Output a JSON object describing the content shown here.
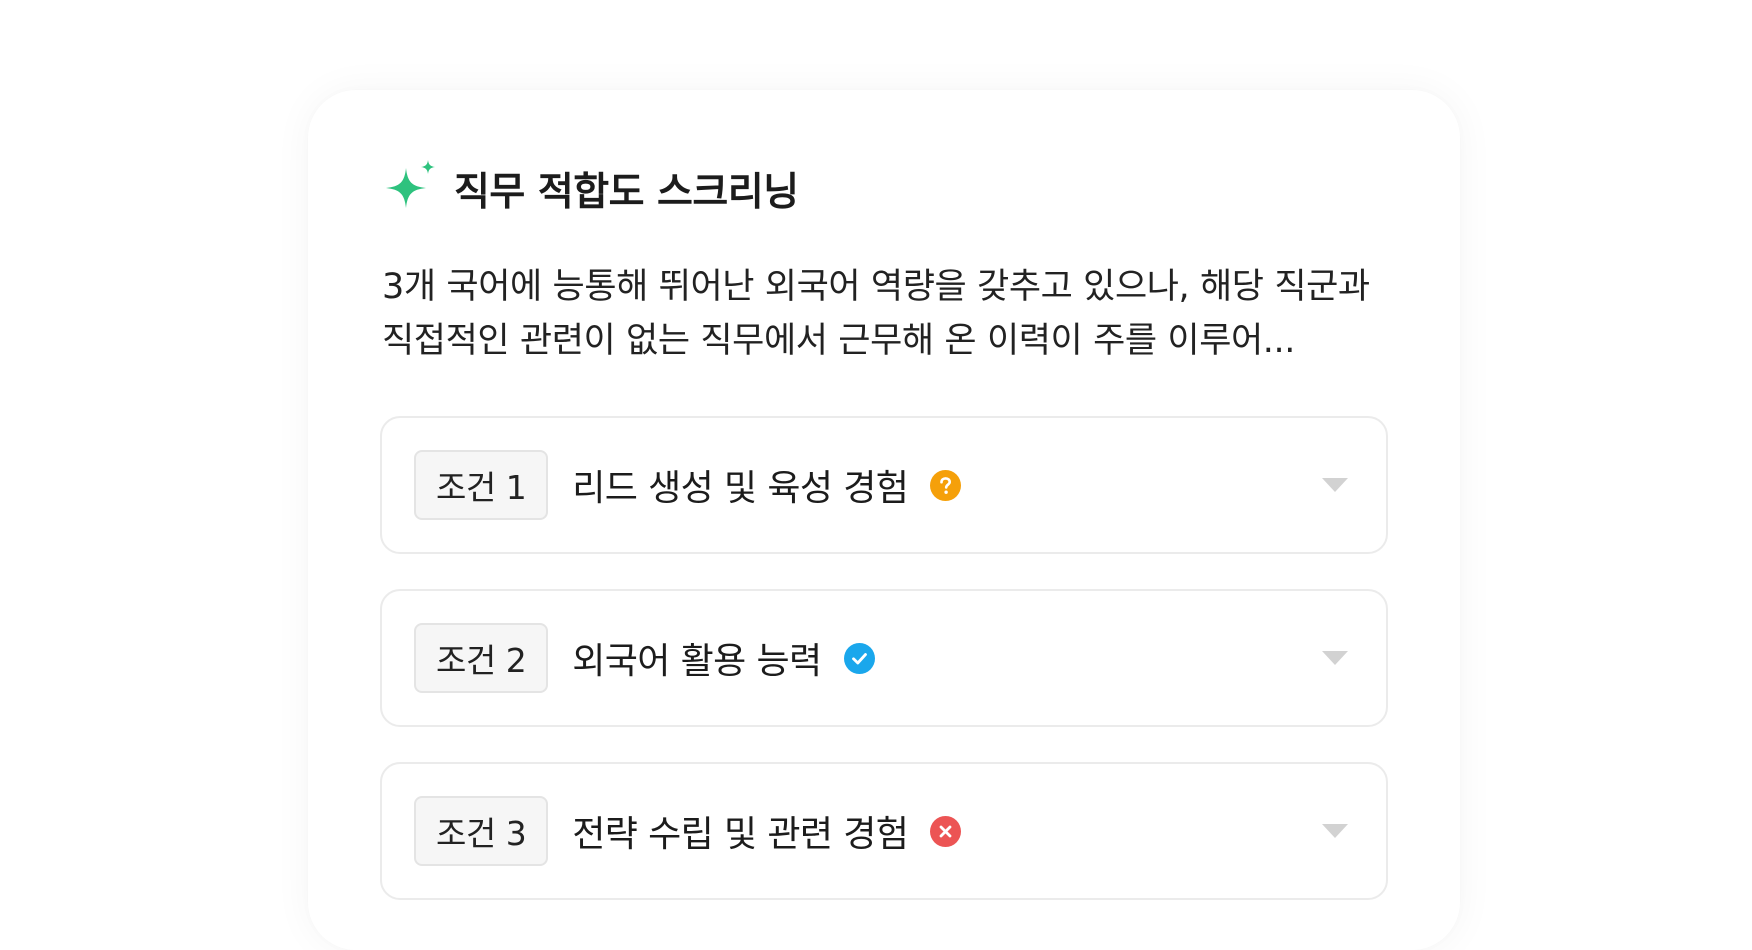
{
  "header": {
    "title": "직무 적합도 스크리닝",
    "icon": "sparkle-icon",
    "accent_color": "#2ec27e"
  },
  "summary": "3개 국어에 능통해 뛰어난 외국어 역량을 갖추고 있으나, 해당 직군과 직접적인 관련이 없는 직무에서 근무해 온 이력이 주를 이루어...",
  "criteria": [
    {
      "tag": "조건 1",
      "label": "리드 생성 및 육성 경험",
      "status": "unknown",
      "status_icon": "question-icon",
      "status_color": "#f5a00a"
    },
    {
      "tag": "조건 2",
      "label": "외국어 활용 능력",
      "status": "met",
      "status_icon": "check-icon",
      "status_color": "#1aa7ec"
    },
    {
      "tag": "조건 3",
      "label": "전략 수립 및 관련 경험",
      "status": "not-met",
      "status_icon": "x-icon",
      "status_color": "#ec5454"
    }
  ]
}
